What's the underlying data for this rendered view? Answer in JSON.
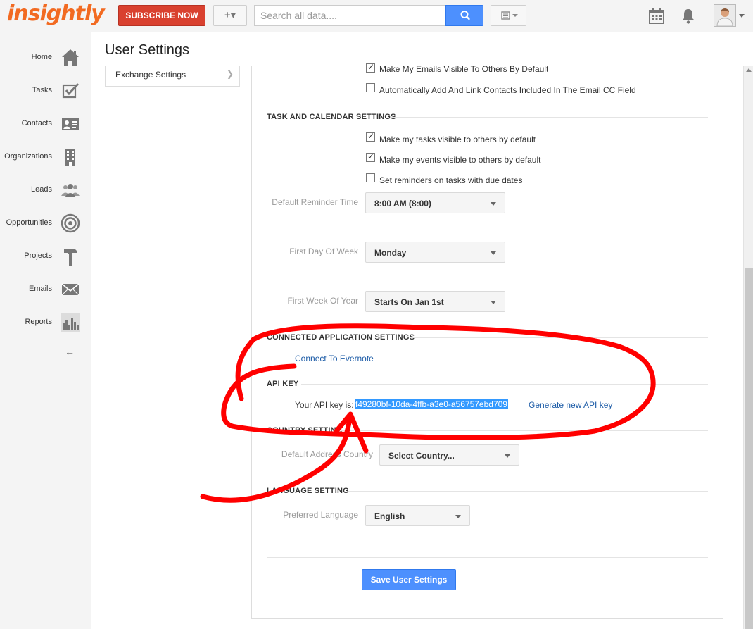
{
  "app": {
    "logo_text": "insightly",
    "subscribe_label": "SUBSCRIBE NOW",
    "add_label": "+▾",
    "search_placeholder": "Search all data....",
    "brand_color": "#f26a21",
    "subscribe_color": "#d9412f",
    "accent_color": "#4d90fe"
  },
  "topbar_icons": [
    "calendar-icon",
    "bell-icon",
    "avatar"
  ],
  "nav": {
    "items": [
      {
        "label": "Home",
        "icon": "home-icon"
      },
      {
        "label": "Tasks",
        "icon": "tasks-icon"
      },
      {
        "label": "Contacts",
        "icon": "contacts-icon"
      },
      {
        "label": "Organizations",
        "icon": "organizations-icon"
      },
      {
        "label": "Leads",
        "icon": "leads-icon"
      },
      {
        "label": "Opportunities",
        "icon": "opportunities-icon"
      },
      {
        "label": "Projects",
        "icon": "projects-icon"
      },
      {
        "label": "Emails",
        "icon": "emails-icon"
      },
      {
        "label": "Reports",
        "icon": "reports-icon"
      }
    ],
    "collapse_label": "←"
  },
  "page": {
    "title": "User Settings",
    "side_menu_item": "Exchange Settings"
  },
  "email_settings": {
    "visible_emails_label": "Make My Emails Visible To Others By Default",
    "visible_emails_checked": true,
    "auto_link_label": "Automatically Add And Link Contacts Included In The Email CC Field",
    "auto_link_checked": false
  },
  "task_calendar": {
    "title": "TASK AND CALENDAR SETTINGS",
    "tasks_visible_label": "Make my tasks visible to others by default",
    "tasks_visible_checked": true,
    "events_visible_label": "Make my events visible to others by default",
    "events_visible_checked": true,
    "reminders_label": "Set reminders on tasks with due dates",
    "reminders_checked": false,
    "reminder_time_label": "Default Reminder Time",
    "reminder_time_value": "8:00 AM (8:00)",
    "first_day_label": "First Day Of Week",
    "first_day_value": "Monday",
    "first_week_label": "First Week Of Year",
    "first_week_value": "Starts On Jan 1st"
  },
  "connected_apps": {
    "title": "CONNECTED APPLICATION SETTINGS",
    "evernote_link": "Connect To Evernote"
  },
  "api_key": {
    "title": "API KEY",
    "prefix": "Your API key is:",
    "value": "f49280bf-10da-4ffb-a3e0-a56757ebd709",
    "generate_link": "Generate new API key"
  },
  "country": {
    "title": "COUNTRY SETTING",
    "label": "Default Address Country",
    "value": "Select Country..."
  },
  "language": {
    "title": "LANGUAGE SETTING",
    "label": "Preferred Language",
    "value": "English"
  },
  "save_label": "Save User Settings",
  "annotation_color": "#ff0000"
}
